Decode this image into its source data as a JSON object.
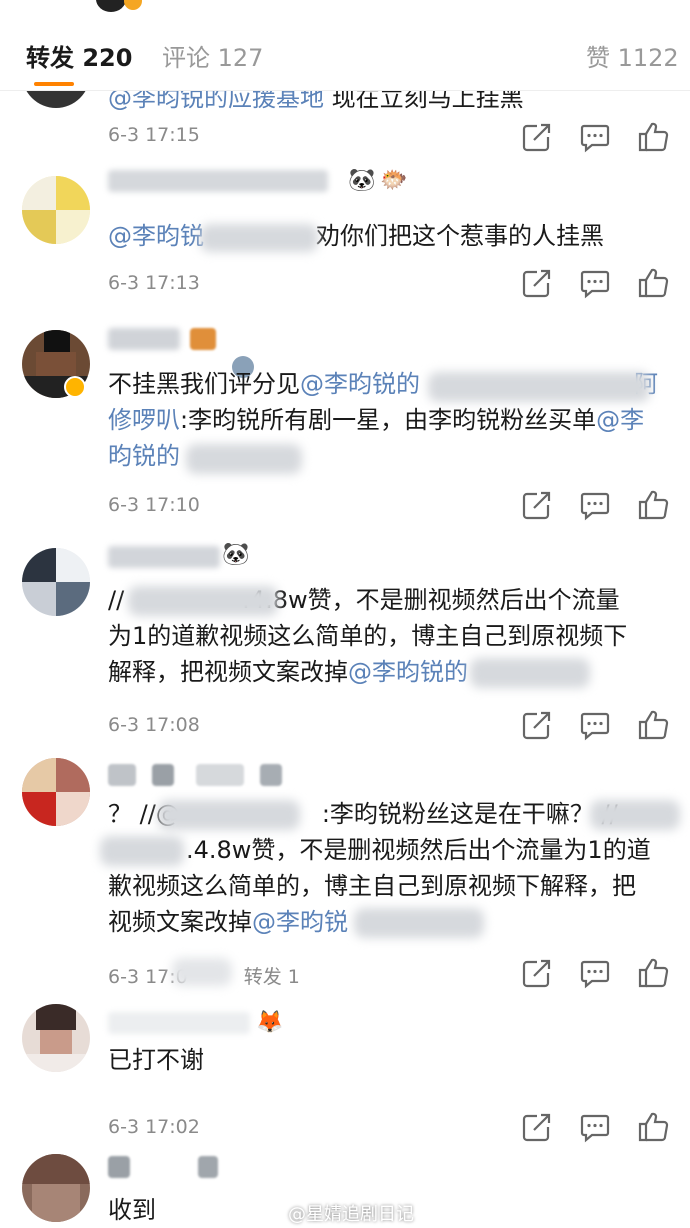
{
  "tabs": {
    "repost": "转发 220",
    "comment": "评论 127",
    "like": "赞 1122"
  },
  "comments": [
    {
      "text_parts": [
        "@李昀锐的应援基地",
        " 现在立刻马上挂黑"
      ],
      "time": "6-3 17:15"
    },
    {
      "emoji": "🐼",
      "emoji2": "🐡",
      "text_parts": [
        "@李昀锐",
        "劝你们把这个惹事的人挂黑"
      ],
      "time": "6-3 17:13"
    },
    {
      "text_parts": [
        "不挂黑我们评分见",
        "@李昀锐的",
        "阿",
        "修啰叭",
        ":李昀锐所有剧一星，由李昀锐粉丝买单",
        "@李",
        "昀锐的"
      ],
      "time": "6-3 17:10"
    },
    {
      "emoji": "🐼",
      "text_parts": [
        "//",
        ".4.8w赞，不是删视频然后出个流量",
        "为1的道歉视频这么简单的，博主自己到原视频下",
        "解释，把视频文案改掉",
        "@李昀锐的"
      ],
      "time": "6-3 17:08"
    },
    {
      "text_parts": [
        "？ //@",
        ":李昀锐粉丝这是在干嘛？ //",
        ".4.8w赞，不是删视频然后出个流量为1的道",
        "歉视频这么简单的，博主自己到原视频下解释，把",
        "视频文案改掉",
        "@李昀锐"
      ],
      "time": "6-3 17:0",
      "repost": "转发 1"
    },
    {
      "emoji": "🦊",
      "text": "已打不谢",
      "time": "6-3 17:02"
    },
    {
      "text": "收到"
    }
  ],
  "watermark": "@星婧追剧日记",
  "colors": {
    "mention": "#5b82b8",
    "time": "#8a8a8a",
    "tab_active": "#1a1a1a",
    "tab_inactive": "#999999",
    "tab_indicator": "#ff8200",
    "verified_badge": "#ffb400"
  },
  "icons": {
    "share": "share-icon",
    "comment": "comment-icon",
    "like": "thumbs-up-icon"
  }
}
